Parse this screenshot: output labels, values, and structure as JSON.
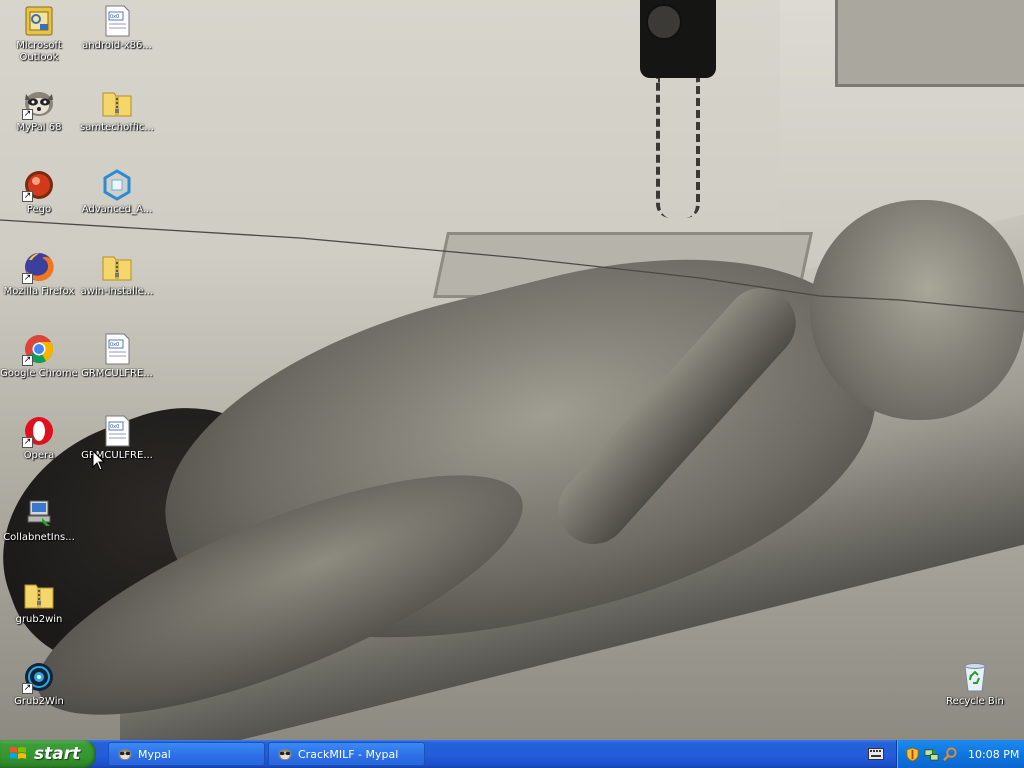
{
  "desktop": {
    "icons": [
      {
        "label": "Microsoft Outlook",
        "line1": "Microsoft",
        "line2": "Outlook",
        "icon": "outlook-icon",
        "shortcut": false
      },
      {
        "label": "android-x86...",
        "icon": "document-icon",
        "shortcut": false
      },
      {
        "label": "MyPal 68",
        "icon": "mypal-icon",
        "shortcut": true
      },
      {
        "label": "samtechoffic...",
        "icon": "zip-folder-icon",
        "shortcut": false
      },
      {
        "label": "Pego",
        "icon": "pego-icon",
        "shortcut": true
      },
      {
        "label": "Advanced_A...",
        "icon": "advanced-installer-icon",
        "shortcut": false
      },
      {
        "label": "Mozilla Firefox",
        "icon": "firefox-icon",
        "shortcut": true
      },
      {
        "label": "awin-installe...",
        "icon": "zip-folder-icon",
        "shortcut": false
      },
      {
        "label": "Google Chrome",
        "icon": "chrome-icon",
        "shortcut": true
      },
      {
        "label": "GRMCULFRE...",
        "icon": "document-icon",
        "shortcut": false
      },
      {
        "label": "Opera",
        "icon": "opera-icon",
        "shortcut": true
      },
      {
        "label": "GRMCULFRE...",
        "icon": "document-icon",
        "shortcut": false
      },
      {
        "label": "CollabnetIns...",
        "icon": "installer-icon",
        "shortcut": false
      },
      {
        "label": "grub2win",
        "icon": "zip-folder-icon",
        "shortcut": false
      },
      {
        "label": "Grub2Win",
        "icon": "grub2win-icon",
        "shortcut": true
      },
      {
        "label": "Recycle Bin",
        "icon": "recycle-bin-icon",
        "shortcut": false
      }
    ]
  },
  "taskbar": {
    "start_label": "start",
    "tasks": [
      {
        "label": "Mypal",
        "icon": "mypal-icon"
      },
      {
        "label": "CrackMILF - Mypal",
        "icon": "mypal-icon"
      }
    ],
    "tray": {
      "icons": [
        "security-shield-icon",
        "network-icon",
        "search-icon"
      ],
      "clock": "10:08 PM"
    }
  },
  "colors": {
    "taskbar_blue": "#245ddb",
    "start_green": "#3c9e3a",
    "tray_blue": "#0f76e0"
  }
}
